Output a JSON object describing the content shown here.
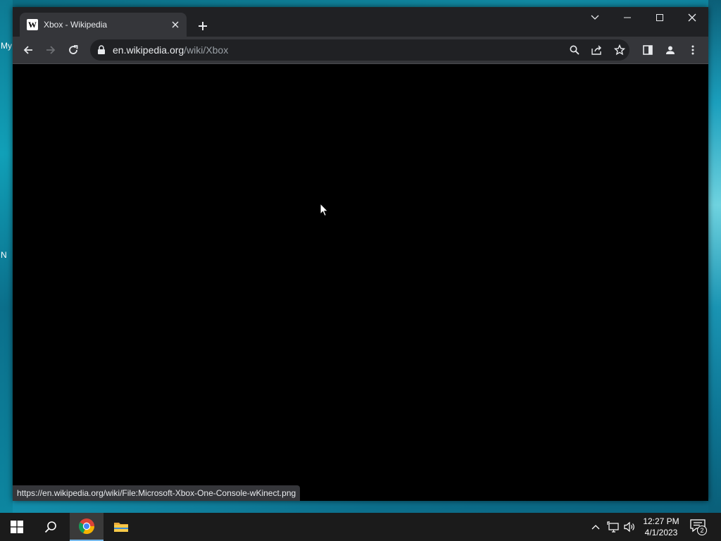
{
  "desktop": {
    "labels": [
      "My",
      "N"
    ]
  },
  "browser": {
    "tab": {
      "title": "Xbox - Wikipedia",
      "favicon_letter": "W"
    },
    "address": {
      "domain": "en.wikipedia.org",
      "path": "/wiki/Xbox"
    },
    "status_url": "https://en.wikipedia.org/wiki/File:Microsoft-Xbox-One-Console-wKinect.png"
  },
  "taskbar": {
    "clock": {
      "time": "12:27 PM",
      "date": "4/1/2023"
    },
    "notification_count": "2"
  },
  "colors": {
    "titlebar": "#202124",
    "toolbar": "#35363a",
    "taskbar": "#1b1b1b",
    "content": "#000000"
  }
}
